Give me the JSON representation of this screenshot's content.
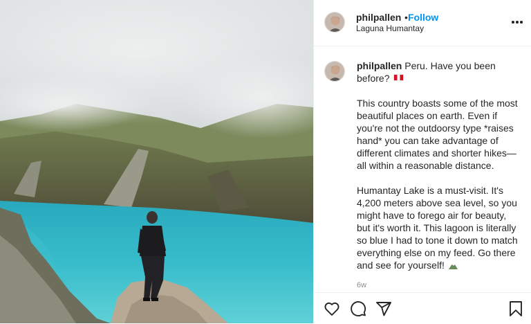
{
  "post": {
    "username": "philpallen",
    "follow_label": "Follow",
    "separator": "•",
    "location": "Laguna Humantay"
  },
  "caption": {
    "username": "philpallen",
    "first_line": "Peru. Have you been before?",
    "paragraph_2": "This country boasts some of the most beautiful places on earth. Even if you're not the outdoorsy type *raises hand* you can take advantage of different climates and shorter hikes—all within a reasonable distance.",
    "paragraph_3": "Humantay Lake is a must-visit. It's 4,200 meters above sea level, so you might have to forego air for beauty, but it's worth it. This lagoon is literally so blue I had to tone it down to match everything else on my feed. Go there and see for yourself!"
  },
  "meta": {
    "time_ago": "6w"
  },
  "icons": {
    "more": "more-options-icon",
    "like": "heart-icon",
    "comment": "comment-icon",
    "share": "share-icon",
    "save": "bookmark-icon",
    "flag": "peru-flag-icon",
    "emoji": "mountain-icon"
  },
  "colors": {
    "follow": "#0095f6",
    "text": "#262626",
    "muted": "#8e8e8e",
    "lake": "#2fb4c9"
  }
}
